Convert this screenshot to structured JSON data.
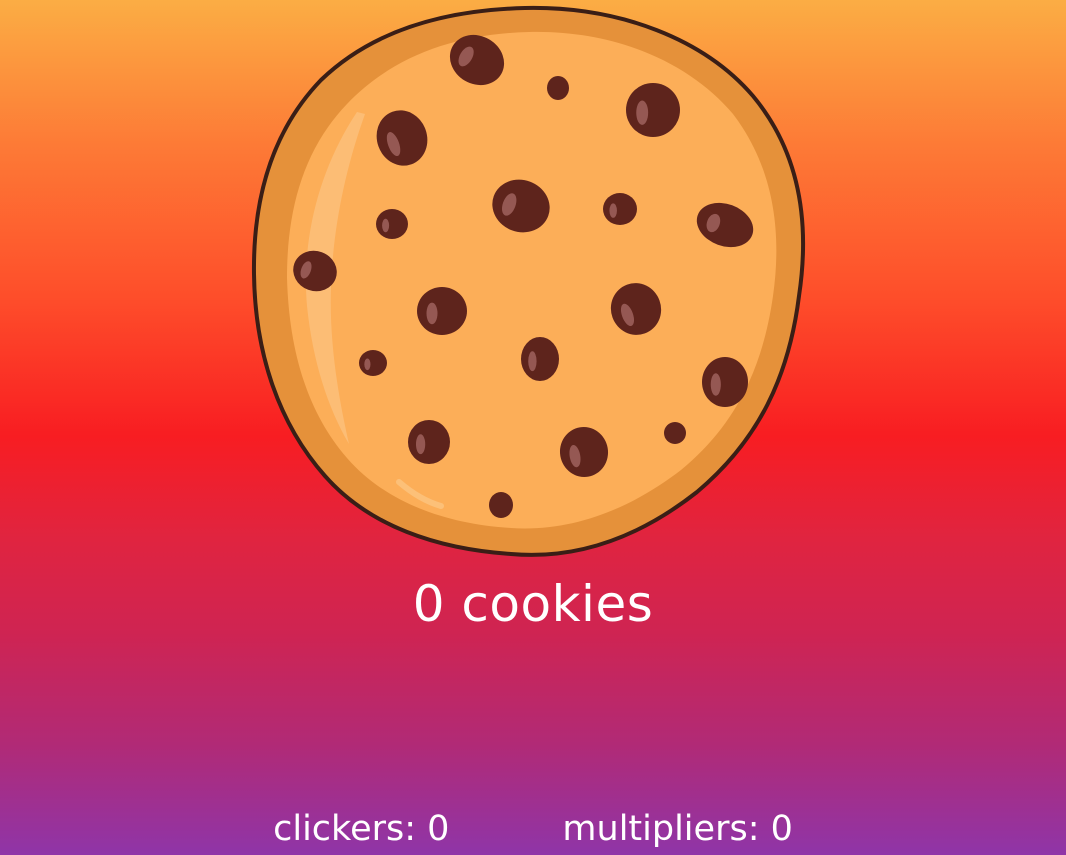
{
  "cookie": {
    "icon": "cookie-icon"
  },
  "counter": {
    "text": "0 cookies"
  },
  "stats": {
    "clickers": "clickers: 0",
    "multipliers": "multipliers: 0"
  },
  "colors": {
    "text": "#ffffff",
    "gradient_top": "#fbad44",
    "gradient_mid": "#f81d22",
    "gradient_bottom": "#8f35a8",
    "cookie_dough": "#fcae58",
    "cookie_rim": "#e5913a",
    "chocolate_chip": "#5e241c"
  }
}
